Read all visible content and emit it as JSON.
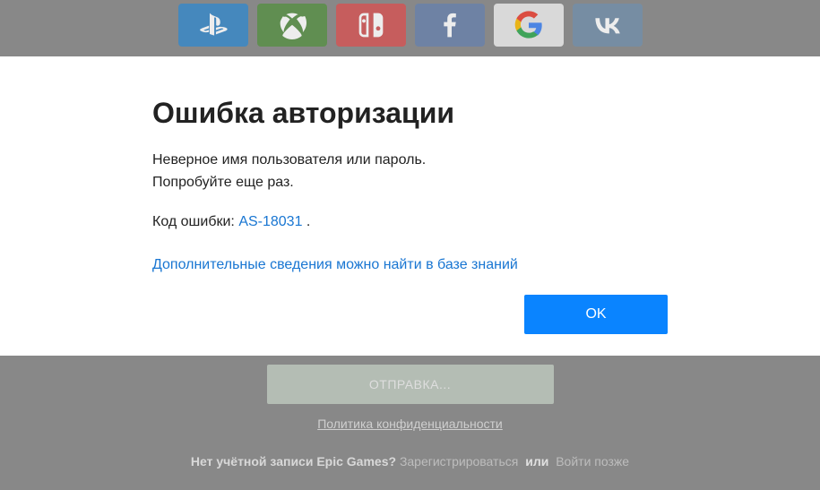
{
  "social": {
    "ps": "playstation",
    "xb": "xbox",
    "ns": "nintendo-switch",
    "fb": "facebook",
    "gg": "google",
    "vk": "vkontakte"
  },
  "modal": {
    "title": "Ошибка авторизации",
    "message_line1": "Неверное имя пользователя или пароль.",
    "message_line2": "Попробуйте еще раз.",
    "error_label": "Код ошибки: ",
    "error_code": "AS-18031",
    "error_suffix": " .",
    "kb_link": "Дополнительные сведения можно найти в базе знаний",
    "ok": "OK"
  },
  "footer": {
    "sending": "ОТПРАВКА...",
    "privacy": "Политика конфиденциальности",
    "no_account": "Нет учётной записи Epic Games?",
    "register": "Зарегистрироваться",
    "or": "или",
    "login_later": "Войти позже"
  }
}
